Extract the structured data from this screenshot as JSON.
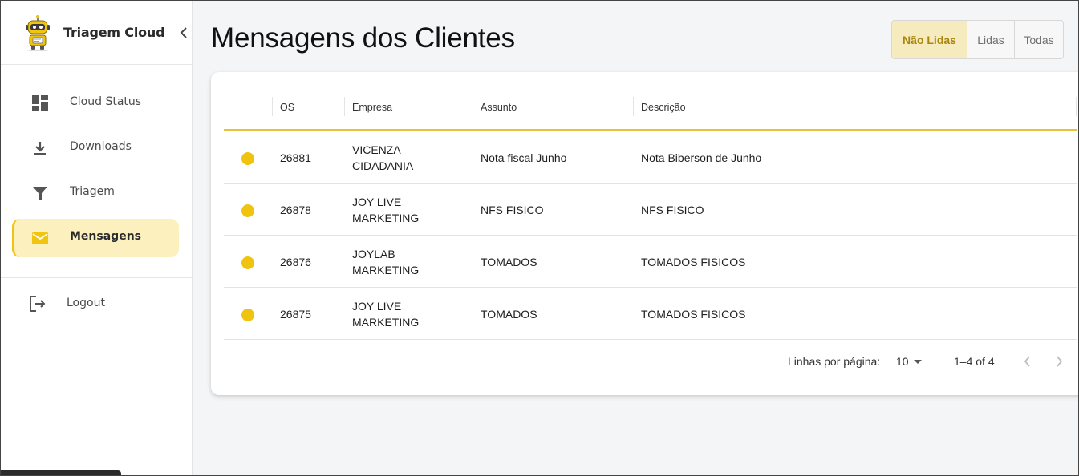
{
  "app": {
    "name": "Triagem Cloud",
    "logo_icon": "robot-logo-icon",
    "accent": "#f1c40f"
  },
  "sidebar": {
    "items": [
      {
        "label": "Cloud Status",
        "icon": "dashboard-icon"
      },
      {
        "label": "Downloads",
        "icon": "download-icon"
      },
      {
        "label": "Triagem",
        "icon": "filter-icon"
      },
      {
        "label": "Mensagens",
        "icon": "mail-icon",
        "active": true
      }
    ],
    "logout": {
      "label": "Logout",
      "icon": "logout-icon"
    }
  },
  "main": {
    "title": "Mensagens dos Clientes",
    "filters": [
      {
        "label": "Não Lidas",
        "active": true
      },
      {
        "label": "Lidas",
        "active": false
      },
      {
        "label": "Todas",
        "active": false
      }
    ]
  },
  "table": {
    "columns": [
      "OS",
      "Empresa",
      "Assunto",
      "Descrição"
    ],
    "rows": [
      {
        "os": "26881",
        "empresa_1": "VICENZA",
        "empresa_2": "CIDADANIA",
        "assunto": "Nota fiscal Junho",
        "descricao": "Nota Biberson de Junho",
        "status_color": "#f0c30f"
      },
      {
        "os": "26878",
        "empresa_1": "JOY LIVE",
        "empresa_2": "MARKETING",
        "assunto": "NFS FISICO",
        "descricao": "NFS FISICO",
        "status_color": "#f0c30f"
      },
      {
        "os": "26876",
        "empresa_1": "JOYLAB",
        "empresa_2": "MARKETING",
        "assunto": "TOMADOS",
        "descricao": "TOMADOS FISICOS",
        "status_color": "#f0c30f"
      },
      {
        "os": "26875",
        "empresa_1": "JOY LIVE",
        "empresa_2": "MARKETING",
        "assunto": "TOMADOS",
        "descricao": "TOMADOS FISICOS",
        "status_color": "#f0c30f"
      }
    ]
  },
  "pagination": {
    "rows_per_page_label": "Linhas por página:",
    "rows_per_page_value": "10",
    "range": "1–4 of 4"
  }
}
